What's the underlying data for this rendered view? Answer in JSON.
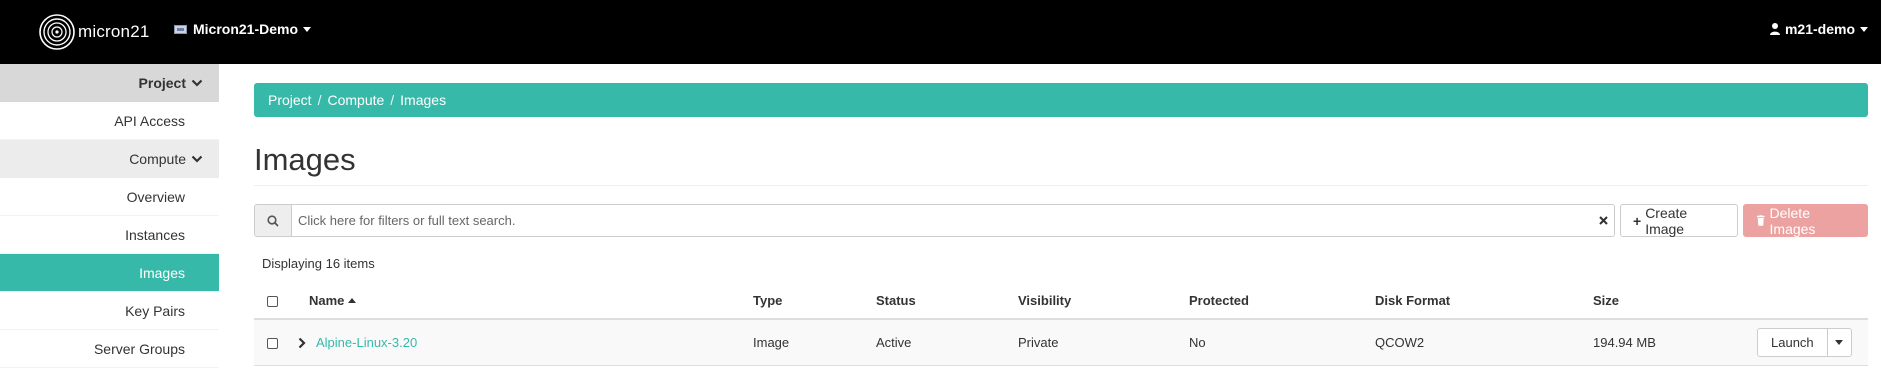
{
  "header": {
    "brand": "micron21",
    "project": "Micron21-Demo",
    "user": "m21-demo"
  },
  "sidebar": {
    "items": [
      {
        "label": "Project",
        "kind": "section-top"
      },
      {
        "label": "API Access",
        "kind": "link"
      },
      {
        "label": "Compute",
        "kind": "section-sub"
      },
      {
        "label": "Overview",
        "kind": "link"
      },
      {
        "label": "Instances",
        "kind": "link"
      },
      {
        "label": "Images",
        "kind": "active"
      },
      {
        "label": "Key Pairs",
        "kind": "link"
      },
      {
        "label": "Server Groups",
        "kind": "link"
      }
    ]
  },
  "breadcrumb": [
    "Project",
    "Compute",
    "Images"
  ],
  "page": {
    "title": "Images"
  },
  "toolbar": {
    "search_placeholder": "Click here for filters or full text search.",
    "create_label": "Create Image",
    "delete_label": "Delete Images"
  },
  "count_text": "Displaying 16 items",
  "table": {
    "columns": [
      "Name",
      "Type",
      "Status",
      "Visibility",
      "Protected",
      "Disk Format",
      "Size"
    ],
    "rows": [
      {
        "name": "Alpine-Linux-3.20",
        "type": "Image",
        "status": "Active",
        "visibility": "Private",
        "protected": "No",
        "disk_format": "QCOW2",
        "size": "194.94 MB",
        "action": "Launch"
      }
    ]
  },
  "icons": {
    "logo": "micron21-logo-icon",
    "search": "search-icon",
    "clear": "close-icon",
    "create": "plus-icon",
    "delete": "trash-icon",
    "user": "user-icon",
    "expand": "chevron-right-icon",
    "section": "chevron-down-icon"
  },
  "colors": {
    "accent": "#37b9a9",
    "topbar": "#000000",
    "danger_disabled": "#eca2a0",
    "link": "#37b9a9"
  }
}
